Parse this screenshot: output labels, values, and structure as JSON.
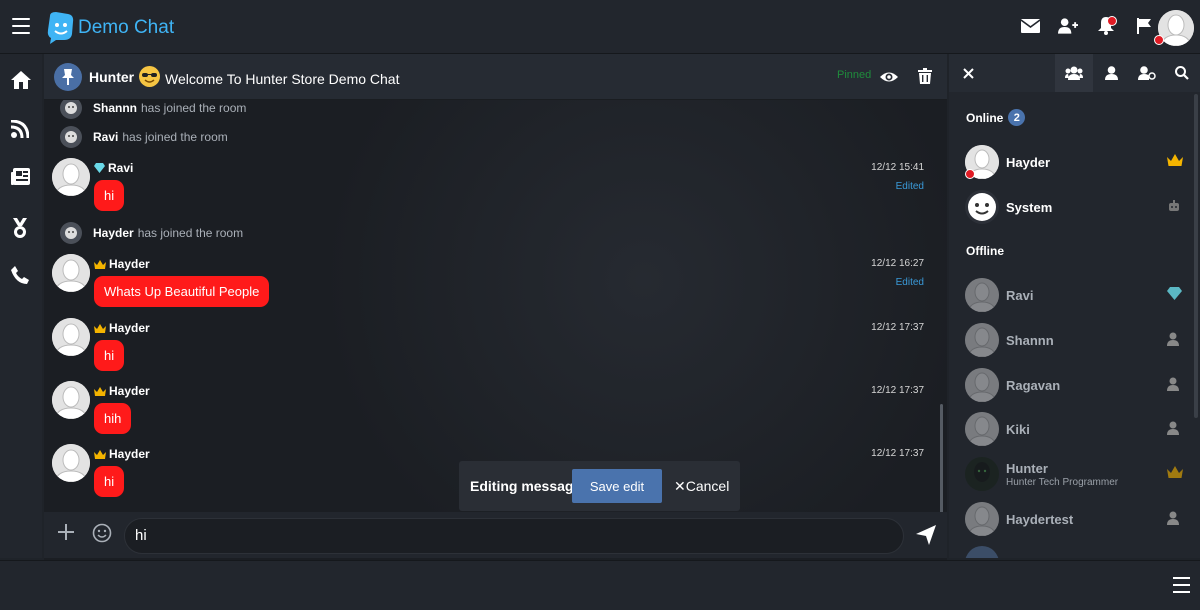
{
  "app": {
    "title": "Demo Chat"
  },
  "room": {
    "name": "Hunter",
    "welcome": "Welcome To Hunter Store Demo Chat",
    "pinned_label": "Pinned"
  },
  "messages": [
    {
      "type": "system",
      "user": "Shannn",
      "text": "has joined the room"
    },
    {
      "type": "system",
      "user": "Ravi",
      "text": "has joined the room"
    },
    {
      "type": "chat",
      "user": "Ravi",
      "rank_icon": "diamond-icon",
      "text": "hi",
      "time": "12/12 15:41",
      "edited": "Edited"
    },
    {
      "type": "system",
      "user": "Hayder",
      "text": "has joined the room"
    },
    {
      "type": "chat",
      "user": "Hayder",
      "rank_icon": "crown-icon",
      "text": "Whats Up Beautiful People",
      "time": "12/12 16:27",
      "edited": "Edited"
    },
    {
      "type": "chat",
      "user": "Hayder",
      "rank_icon": "crown-icon",
      "text": "hi",
      "time": "12/12 17:37"
    },
    {
      "type": "chat",
      "user": "Hayder",
      "rank_icon": "crown-icon",
      "text": "hih",
      "time": "12/12 17:37"
    },
    {
      "type": "chat",
      "user": "Hayder",
      "rank_icon": "crown-icon",
      "text": "hi",
      "time": "12/12 17:37"
    }
  ],
  "edit_bar": {
    "label": "Editing message",
    "save": "Save edit",
    "cancel": "✕Cancel"
  },
  "composer": {
    "value": "hi"
  },
  "sidebar": {
    "online_title": "Online",
    "online_count": "2",
    "offline_title": "Offline",
    "online": [
      {
        "name": "Hayder",
        "badge": "crown-icon"
      },
      {
        "name": "System",
        "badge": "robot-icon"
      }
    ],
    "offline": [
      {
        "name": "Ravi",
        "badge": "diamond-icon"
      },
      {
        "name": "Shannn",
        "badge": "user-icon"
      },
      {
        "name": "Ragavan",
        "badge": "user-icon"
      },
      {
        "name": "Kiki",
        "badge": "user-icon"
      },
      {
        "name": "Hunter",
        "sub": "Hunter Tech Programmer",
        "badge": "crown-icon"
      },
      {
        "name": "Haydertest",
        "badge": "user-icon"
      }
    ]
  },
  "colors": {
    "accent": "#3fb4f5",
    "bubble": "#ff1a1a",
    "button": "#4a73ad",
    "pinned": "#1f8c3c",
    "edited": "#3a9ad9"
  }
}
